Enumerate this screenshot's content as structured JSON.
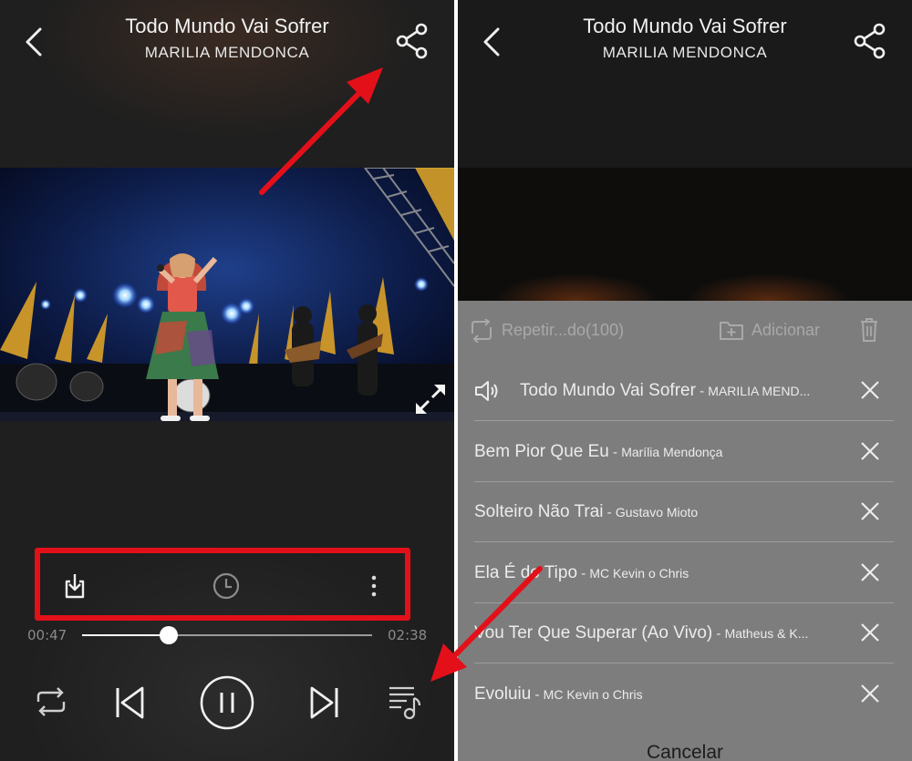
{
  "player": {
    "title": "Todo Mundo Vai Sofrer",
    "artist": "MARILIA MENDONCA",
    "current_time": "00:47",
    "total_time": "02:38",
    "progress": 0.3,
    "icons": {
      "back": "chevron-left-icon",
      "share": "share-icon",
      "fullscreen": "expand-icon",
      "download": "download-icon",
      "timer": "clock-icon",
      "more": "more-vertical-icon",
      "repeat": "repeat-icon",
      "previous": "skip-previous-icon",
      "pause": "pause-icon",
      "next": "skip-next-icon",
      "playlist": "playlist-icon"
    }
  },
  "queue_sheet": {
    "repeat_label": "Repetir...do(100)",
    "add_label": "Adicionar",
    "cancel_label": "Cancelar",
    "items": [
      {
        "title": "Todo Mundo Vai Sofrer",
        "artist": "MARILIA MEND...",
        "playing": true
      },
      {
        "title": "Bem Pior Que Eu",
        "artist": "Marília Mendonça",
        "playing": false
      },
      {
        "title": "Solteiro Não Trai",
        "artist": "Gustavo Mioto",
        "playing": false
      },
      {
        "title": "Ela É do Tipo",
        "artist": "MC Kevin o Chris",
        "playing": false
      },
      {
        "title": "Vou Ter Que Superar (Ao Vivo)",
        "artist": "Matheus & K...",
        "playing": false
      },
      {
        "title": "Evoluiu",
        "artist": "MC Kevin o Chris",
        "playing": false
      }
    ],
    "separator": " - "
  },
  "colors": {
    "highlight": "#e3101a",
    "background": "#232323",
    "sheet": "#7d7d7d"
  }
}
